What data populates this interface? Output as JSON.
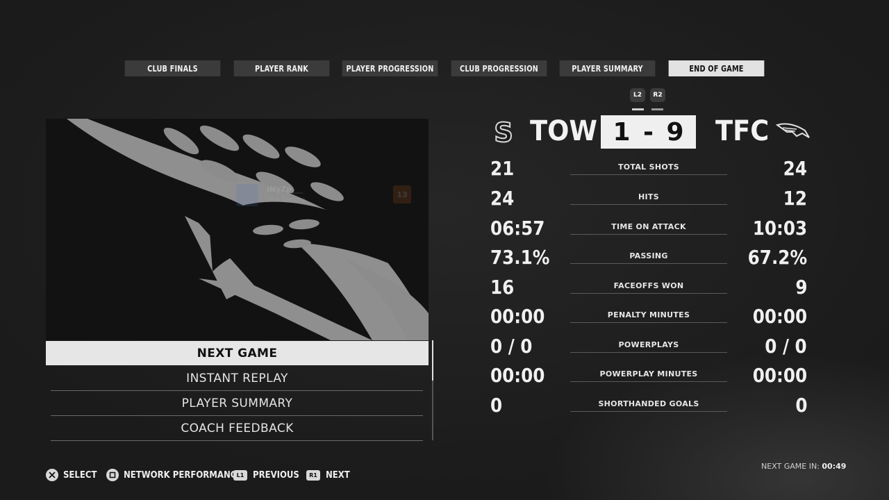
{
  "tabs": [
    {
      "label": "CLUB FINALS",
      "active": false
    },
    {
      "label": "PLAYER RANK",
      "active": false
    },
    {
      "label": "PLAYER PROGRESSION",
      "active": false
    },
    {
      "label": "CLUB PROGRESSION",
      "active": false
    },
    {
      "label": "PLAYER SUMMARY",
      "active": false
    },
    {
      "label": "END OF GAME",
      "active": true
    }
  ],
  "triggers": {
    "left": "L2",
    "right": "R2"
  },
  "preview_overlay": {
    "name": "iNyZp___",
    "subtitle": "Jose Spectre",
    "level": "13"
  },
  "menu": {
    "items": [
      "NEXT GAME",
      "INSTANT REPLAY",
      "PLAYER SUMMARY",
      "COACH FEEDBACK"
    ],
    "selected_index": 0
  },
  "scoreboard": {
    "home_logo_letter": "S",
    "home": "TOW",
    "away": "TFC",
    "score": "1 - 9"
  },
  "stats": [
    {
      "label": "TOTAL SHOTS",
      "home": "21",
      "away": "24"
    },
    {
      "label": "HITS",
      "home": "24",
      "away": "12"
    },
    {
      "label": "TIME ON ATTACK",
      "home": "06:57",
      "away": "10:03"
    },
    {
      "label": "PASSING",
      "home": "73.1%",
      "away": "67.2%"
    },
    {
      "label": "FACEOFFS WON",
      "home": "16",
      "away": "9"
    },
    {
      "label": "PENALTY MINUTES",
      "home": "00:00",
      "away": "00:00"
    },
    {
      "label": "POWERPLAYS",
      "home": "0 / 0",
      "away": "0 / 0"
    },
    {
      "label": "POWERPLAY MINUTES",
      "home": "00:00",
      "away": "00:00"
    },
    {
      "label": "SHORTHANDED GOALS",
      "home": "0",
      "away": "0"
    }
  ],
  "hints": [
    {
      "button": "cross",
      "label": "SELECT"
    },
    {
      "button": "square",
      "label": "NETWORK PERFORMANCE"
    },
    {
      "button": "L1",
      "label": "PREVIOUS"
    },
    {
      "button": "R1",
      "label": "NEXT"
    }
  ],
  "next_game": {
    "label": "NEXT GAME IN:",
    "time": "00:49"
  }
}
